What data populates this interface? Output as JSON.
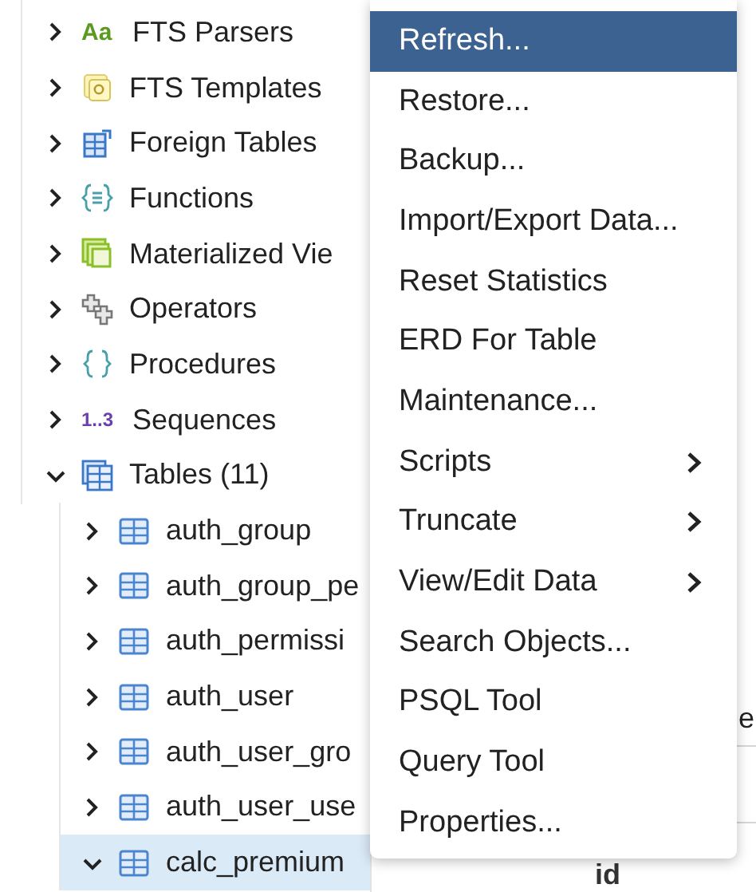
{
  "tree": [
    {
      "label": "FTS Parsers",
      "kind": "parser",
      "icon_text": "Aa",
      "expanded": false,
      "selected": false
    },
    {
      "label": "FTS Templates",
      "kind": "template",
      "expanded": false,
      "selected": false
    },
    {
      "label": "Foreign Tables",
      "kind": "foreign_table",
      "expanded": false,
      "selected": false
    },
    {
      "label": "Functions",
      "kind": "function",
      "expanded": false,
      "selected": false
    },
    {
      "label": "Materialized Vie",
      "kind": "matview",
      "expanded": false,
      "selected": false
    },
    {
      "label": "Operators",
      "kind": "operator",
      "expanded": false,
      "selected": false
    },
    {
      "label": "Procedures",
      "kind": "procedure",
      "expanded": false,
      "selected": false
    },
    {
      "label": "Sequences",
      "kind": "sequence",
      "icon_text": "1..3",
      "expanded": false,
      "selected": false
    },
    {
      "label": "Tables (11)",
      "kind": "tables",
      "expanded": true,
      "selected": false,
      "children": [
        {
          "label": "auth_group",
          "kind": "table",
          "expanded": false,
          "selected": false
        },
        {
          "label": "auth_group_pe",
          "kind": "table",
          "expanded": false,
          "selected": false
        },
        {
          "label": "auth_permissi",
          "kind": "table",
          "expanded": false,
          "selected": false
        },
        {
          "label": "auth_user",
          "kind": "table",
          "expanded": false,
          "selected": false
        },
        {
          "label": "auth_user_gro",
          "kind": "table",
          "expanded": false,
          "selected": false
        },
        {
          "label": "auth_user_use",
          "kind": "table",
          "expanded": false,
          "selected": false
        },
        {
          "label": "calc_premium",
          "kind": "table",
          "expanded": true,
          "selected": true
        }
      ]
    }
  ],
  "context_menu": [
    {
      "label": "Refresh...",
      "selected": true,
      "submenu": false
    },
    {
      "label": "Restore...",
      "selected": false,
      "submenu": false
    },
    {
      "label": "Backup...",
      "selected": false,
      "submenu": false
    },
    {
      "label": "Import/Export Data...",
      "selected": false,
      "submenu": false
    },
    {
      "label": "Reset Statistics",
      "selected": false,
      "submenu": false
    },
    {
      "label": "ERD For Table",
      "selected": false,
      "submenu": false
    },
    {
      "label": "Maintenance...",
      "selected": false,
      "submenu": false
    },
    {
      "label": "Scripts",
      "selected": false,
      "submenu": true
    },
    {
      "label": "Truncate",
      "selected": false,
      "submenu": true
    },
    {
      "label": "View/Edit Data",
      "selected": false,
      "submenu": true
    },
    {
      "label": "Search Objects...",
      "selected": false,
      "submenu": false
    },
    {
      "label": "PSQL Tool",
      "selected": false,
      "submenu": false
    },
    {
      "label": "Query Tool",
      "selected": false,
      "submenu": false
    },
    {
      "label": "Properties...",
      "selected": false,
      "submenu": false
    }
  ],
  "right_panel": {
    "label": "e",
    "cell": "id"
  }
}
